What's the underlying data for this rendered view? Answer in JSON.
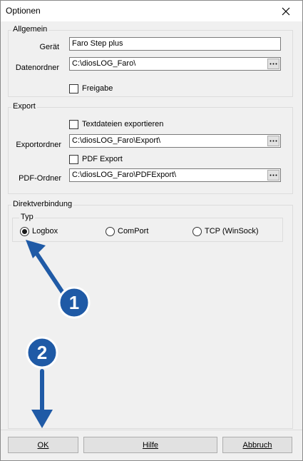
{
  "window": {
    "title": "Optionen",
    "close_icon": "close-icon"
  },
  "allgemein": {
    "legend": "Allgemein",
    "geraet_label": "Gerät",
    "geraet_value": "Faro Step plus",
    "datenordner_label": "Datenordner",
    "datenordner_value": "C:\\diosLOG_Faro\\",
    "freigabe_label": "Freigabe",
    "freigabe_checked": false
  },
  "export": {
    "legend": "Export",
    "textdateien_label": "Textdateien exportieren",
    "textdateien_checked": false,
    "exportordner_label": "Exportordner",
    "exportordner_value": "C:\\diosLOG_Faro\\Export\\",
    "pdf_export_label": "PDF Export",
    "pdf_export_checked": false,
    "pdf_ordner_label": "PDF-Ordner",
    "pdf_ordner_value": "C:\\diosLOG_Faro\\PDFExport\\"
  },
  "direktverbindung": {
    "legend": "Direktverbindung",
    "typ_legend": "Typ",
    "options": [
      "Logbox",
      "ComPort",
      "TCP (WinSock)"
    ],
    "selected": "Logbox"
  },
  "browse_label": "...",
  "annotations": {
    "step1": "1",
    "step2": "2",
    "color": "#1f5aa6"
  },
  "footer": {
    "ok": "OK",
    "hilfe": "Hilfe",
    "abbruch": "Abbruch"
  }
}
